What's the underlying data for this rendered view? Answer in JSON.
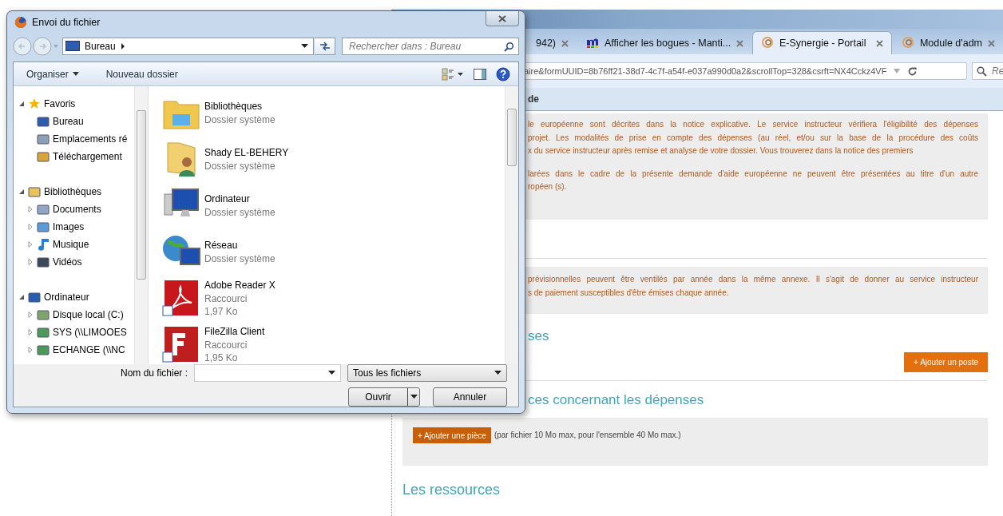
{
  "dialog": {
    "title": "Envoi du fichier",
    "breadcrumb": "Bureau",
    "search_placeholder": "Rechercher dans : Bureau",
    "toolbar": [
      {
        "label": "Organiser",
        "kind": "menu"
      },
      {
        "label": "Nouveau dossier",
        "kind": "plain"
      }
    ],
    "nav_tree": [
      {
        "label": "Favoris",
        "kind": "star",
        "expanded": true,
        "children": [
          {
            "label": "Bureau",
            "kind": "desktop"
          },
          {
            "label": "Emplacements ré",
            "kind": "places"
          },
          {
            "label": "Téléchargement",
            "kind": "download"
          }
        ]
      },
      {
        "label": "Bibliothèques",
        "kind": "library",
        "expanded": true,
        "children": [
          {
            "label": "Documents",
            "kind": "document",
            "expanded": false
          },
          {
            "label": "Images",
            "kind": "image",
            "expanded": false
          },
          {
            "label": "Musique",
            "kind": "music",
            "expanded": false
          },
          {
            "label": "Vidéos",
            "kind": "video",
            "expanded": false
          }
        ]
      },
      {
        "label": "Ordinateur",
        "kind": "computer",
        "expanded": true,
        "children": [
          {
            "label": "Disque local (C:)",
            "kind": "drive",
            "expanded": false
          },
          {
            "label": "SYS (\\\\LIMOOES",
            "kind": "netdrive",
            "expanded": false
          },
          {
            "label": "ECHANGE (\\\\NC",
            "kind": "netdrive",
            "expanded": false
          }
        ]
      }
    ],
    "files": [
      {
        "name": "Bibliothèques",
        "detail": "Dossier système",
        "kind": "library"
      },
      {
        "name": "Shady EL-BEHERY",
        "detail": "Dossier système",
        "kind": "user"
      },
      {
        "name": "Ordinateur",
        "detail": "Dossier système",
        "kind": "computer"
      },
      {
        "name": "Réseau",
        "detail": "Dossier système",
        "kind": "network"
      },
      {
        "name": "Adobe Reader X",
        "detail": "Raccourci",
        "size": "1,97 Ko",
        "kind": "pdf"
      },
      {
        "name": "FileZilla Client",
        "detail": "Raccourci",
        "size": "1,95 Ko",
        "kind": "filezilla"
      }
    ],
    "filename_label": "Nom du fichier :",
    "file_type": "Tous les fichiers",
    "buttons": [
      {
        "label": "Ouvrir",
        "kind": "split"
      },
      {
        "label": "Annuler",
        "kind": "plain"
      }
    ]
  },
  "browser": {
    "tabs": [
      {
        "label": "942)",
        "selected": false,
        "kind": "plain"
      },
      {
        "label": "Afficher les bogues - Manti...",
        "selected": false,
        "kind": "mantis"
      },
      {
        "label": "E-Synergie - Portail",
        "selected": true,
        "kind": "synergie"
      },
      {
        "label": "Module d'adm",
        "selected": false,
        "kind": "synergie"
      }
    ],
    "url": "aire&formUUID=8b76ff21-38d7-4c7f-a54f-e037a990d0a2&scrollTop=328&csrft=NX4Cckz4VF",
    "search_placeholder": "Re",
    "menu_fragment": "de",
    "notice_1": [
      [
        "le européenne sont décrites dans la notice explicative. Le service instructeur vérifiera l'éligibilité des dépenses",
        "projet. Les modalités de prise en compte des dépenses (au réel, et/ou sur la base de la procédure des coûts",
        "x du service instructeur après remise et analyse de votre dossier. Vous trouverez dans la notice des premiers"
      ],
      [
        "larées dans le cadre de la présente demande d'aide européenne ne peuvent être présentées au titre d'un autre",
        "ropéen (s)."
      ]
    ],
    "notice_2": [
      [
        "prévisionnelles peuvent être ventilés par année dans la même annexe. Il s'agit de donner au service instructeur",
        "s de paiement susceptibles d'être émises chaque année."
      ]
    ],
    "heading_1": "ses",
    "add_post_button": "+ Ajouter un poste",
    "heading_2": "ces concernant les dépenses",
    "add_piece_button": "+ Ajouter une pièce",
    "upload_note": "(par fichier 10 Mo max, pour l'ensemble 40 Mo max.)",
    "heading_3": "Les ressources"
  }
}
